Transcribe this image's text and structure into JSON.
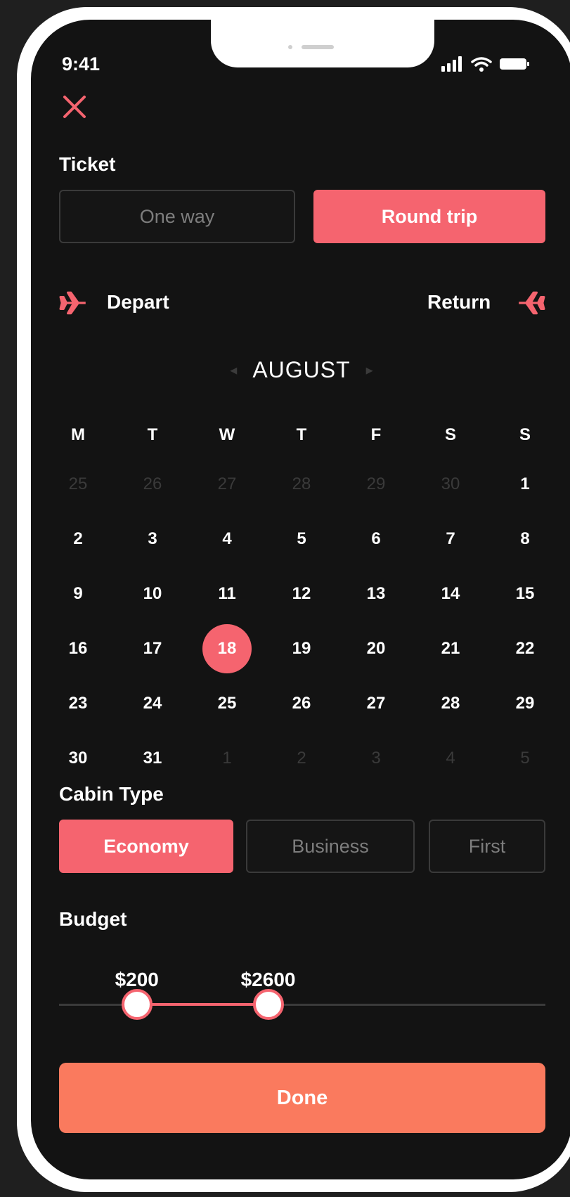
{
  "status_bar": {
    "time": "9:41"
  },
  "ticket": {
    "label": "Ticket",
    "options": [
      "One way",
      "Round trip"
    ],
    "selected": "Round trip"
  },
  "trip": {
    "depart_label": "Depart",
    "return_label": "Return"
  },
  "calendar": {
    "month": "AUGUST",
    "weekdays": [
      "M",
      "T",
      "W",
      "T",
      "F",
      "S",
      "S"
    ],
    "weeks": [
      [
        {
          "d": "25",
          "m": true
        },
        {
          "d": "26",
          "m": true
        },
        {
          "d": "27",
          "m": true
        },
        {
          "d": "28",
          "m": true
        },
        {
          "d": "29",
          "m": true
        },
        {
          "d": "30",
          "m": true
        },
        {
          "d": "1"
        }
      ],
      [
        {
          "d": "2"
        },
        {
          "d": "3"
        },
        {
          "d": "4"
        },
        {
          "d": "5"
        },
        {
          "d": "6"
        },
        {
          "d": "7"
        },
        {
          "d": "8"
        }
      ],
      [
        {
          "d": "9"
        },
        {
          "d": "10"
        },
        {
          "d": "11"
        },
        {
          "d": "12"
        },
        {
          "d": "13"
        },
        {
          "d": "14"
        },
        {
          "d": "15"
        }
      ],
      [
        {
          "d": "16"
        },
        {
          "d": "17"
        },
        {
          "d": "18",
          "sel": true
        },
        {
          "d": "19"
        },
        {
          "d": "20"
        },
        {
          "d": "21"
        },
        {
          "d": "22"
        }
      ],
      [
        {
          "d": "23"
        },
        {
          "d": "24"
        },
        {
          "d": "25"
        },
        {
          "d": "26"
        },
        {
          "d": "27"
        },
        {
          "d": "28"
        },
        {
          "d": "29"
        }
      ],
      [
        {
          "d": "30"
        },
        {
          "d": "31"
        },
        {
          "d": "1",
          "m": true
        },
        {
          "d": "2",
          "m": true
        },
        {
          "d": "3",
          "m": true
        },
        {
          "d": "4",
          "m": true
        },
        {
          "d": "5",
          "m": true
        }
      ]
    ]
  },
  "cabin": {
    "label": "Cabin Type",
    "options": [
      "Economy",
      "Business",
      "First"
    ],
    "selected": "Economy"
  },
  "budget": {
    "label": "Budget",
    "min_label": "$200",
    "max_label": "$2600",
    "min_fraction": 0.16,
    "max_fraction": 0.43
  },
  "done_label": "Done",
  "colors": {
    "accent": "#f5646f",
    "done": "#fa7a5e",
    "screen_bg": "#131313",
    "muted": "#3a3a3a"
  }
}
